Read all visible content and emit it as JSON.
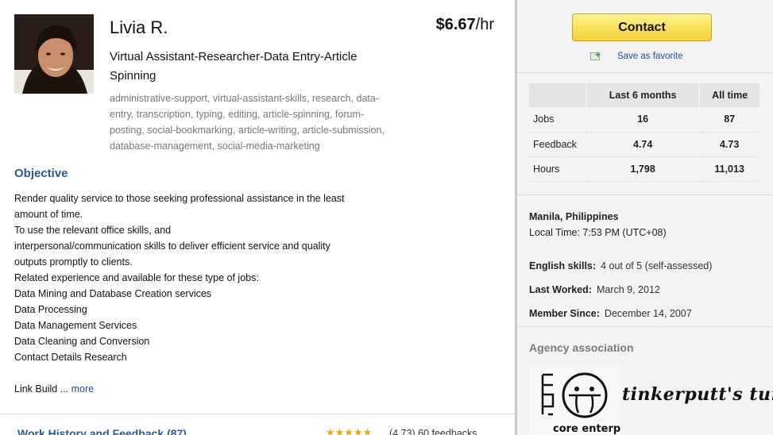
{
  "profile": {
    "name": "Livia R.",
    "rate_amount": "$6.67",
    "rate_unit": "/hr",
    "headline": "Virtual Assistant-Researcher-Data Entry-Article Spinning",
    "skills": "administrative-support, virtual-assistant-skills, research, data-entry, transcription, typing, editing, article-spinning, forum-posting, social-bookmarking, article-writing, article-submission, database-management, social-media-marketing"
  },
  "objective": {
    "title": "Objective",
    "lines": [
      "Render quality service to those seeking professional assistance in the least",
      "amount of time.",
      "To use the relevant office skills, and",
      "interpersonal/communication skills to deliver efficient service and quality",
      "outputs promptly to clients.",
      "Related experience and available for these type of jobs:",
      "Data Mining and Database Creation services",
      "Data Processing",
      "Data Management Services",
      "Data Cleaning and Conversion",
      "Contact Details Research"
    ],
    "link_build_text": "Link Build ...",
    "more_label": "more"
  },
  "work_history": {
    "title": "Work History and Feedback (87)",
    "stars": "★★★★★",
    "rating_text": "(4.73)  60 feedbacks"
  },
  "sidebar": {
    "contact_label": "Contact",
    "save_favorite_label": "Save as favorite",
    "stats": {
      "headers": [
        "",
        "Last 6 months",
        "All time"
      ],
      "rows": [
        {
          "label": "Jobs",
          "last6": "16",
          "all": "87"
        },
        {
          "label": "Feedback",
          "last6": "4.74",
          "all": "4.73"
        },
        {
          "label": "Hours",
          "last6": "1,798",
          "all": "11,013"
        }
      ]
    },
    "location": "Manila, Philippines",
    "local_time": "Local Time: 7:53 PM (UTC+08)",
    "english_label": "English skills:",
    "english_value": "4 out of 5 (self-assessed)",
    "last_worked_label": "Last Worked:",
    "last_worked_value": "March 9, 2012",
    "member_since_label": "Member Since:",
    "member_since_value": "December 14, 2007",
    "agency_title": "Agency association",
    "agency_logo_text": "core enterprises",
    "agency_name": "tinkerputt's turf"
  }
}
